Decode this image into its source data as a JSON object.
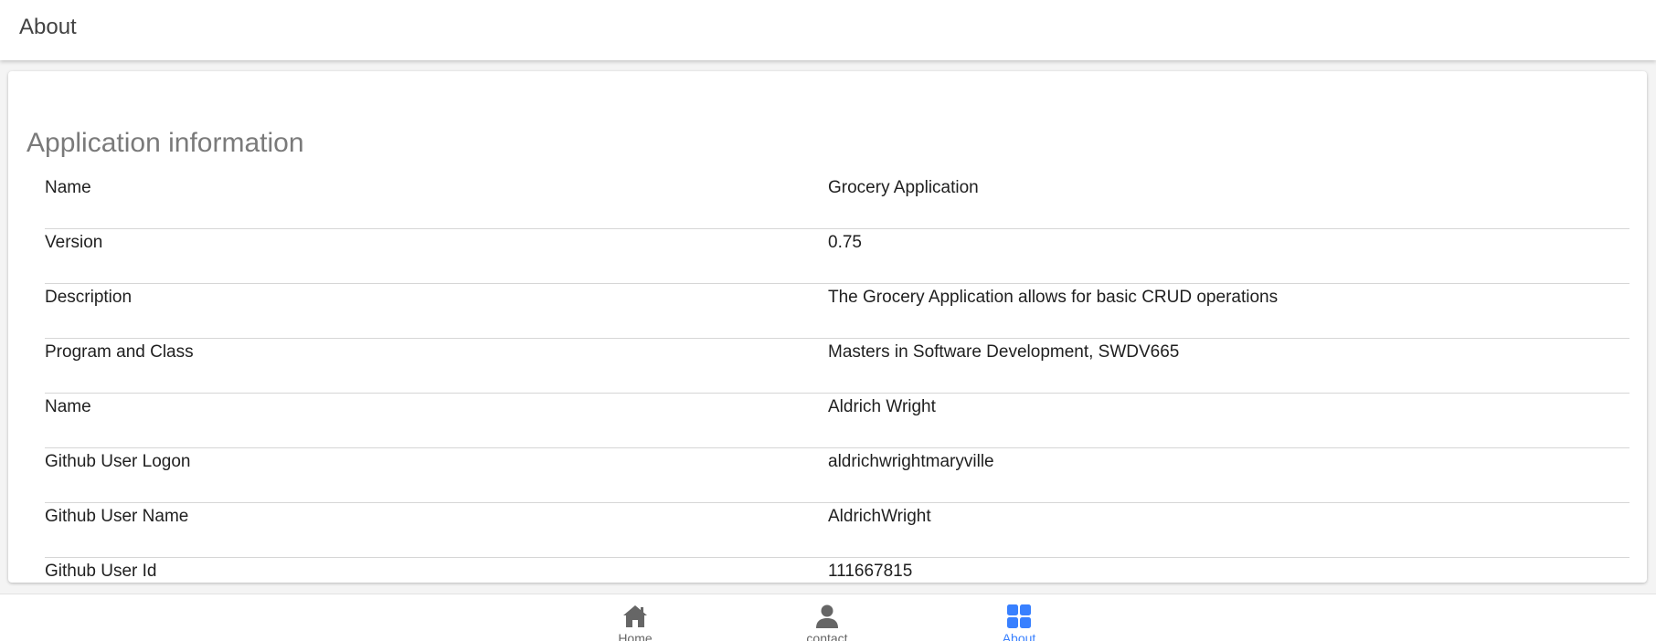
{
  "header": {
    "title": "About"
  },
  "card": {
    "title": "Application information",
    "rows": [
      {
        "label": "Name",
        "value": "Grocery Application"
      },
      {
        "label": "Version",
        "value": "0.75"
      },
      {
        "label": "Description",
        "value": "The Grocery Application allows for basic CRUD operations"
      },
      {
        "label": "Program and Class",
        "value": "Masters in Software Development, SWDV665"
      },
      {
        "label": "Name",
        "value": "Aldrich Wright"
      },
      {
        "label": "Github User Logon",
        "value": "aldrichwrightmaryville"
      },
      {
        "label": "Github User Name",
        "value": "AldrichWright"
      },
      {
        "label": "Github User Id",
        "value": "111667815"
      }
    ]
  },
  "tabs": [
    {
      "label": "Home",
      "icon": "home-icon",
      "active": false
    },
    {
      "label": "contact",
      "icon": "person-icon",
      "active": false
    },
    {
      "label": "About",
      "icon": "apps-icon",
      "active": true
    }
  ],
  "colors": {
    "accent": "#3880ff",
    "inactive_icon": "#666666"
  }
}
